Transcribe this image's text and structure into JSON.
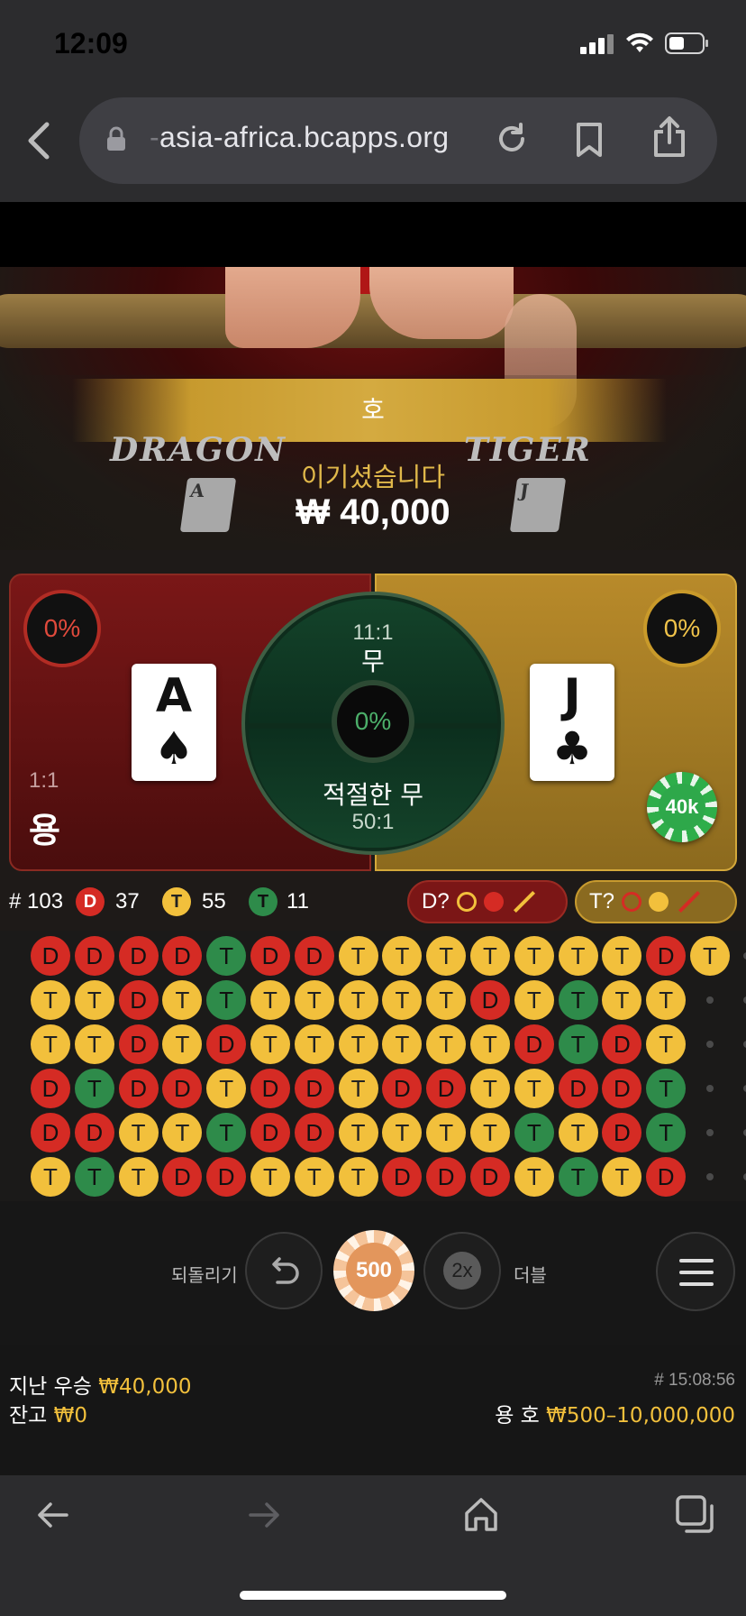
{
  "status_bar": {
    "time": "12:09"
  },
  "browser": {
    "url_prefix": "-",
    "url": "asia-africa.bcapps.org"
  },
  "video": {
    "banner_text": "호",
    "logo_dragon": "DRAGON",
    "logo_tiger": "TIGER",
    "small_card_dragon": "A",
    "small_card_tiger": "J",
    "win_label": "이기셨습니다",
    "win_amount": "₩ 40,000"
  },
  "bet": {
    "dragon": {
      "pct": "0%",
      "card_rank": "A",
      "card_suit": "♠",
      "odds": "1:1",
      "name": "용"
    },
    "tiger": {
      "pct": "0%",
      "card_rank": "J",
      "card_suit": "♣",
      "chip": "40k"
    },
    "tie": {
      "odds": "11:1",
      "label": "무",
      "pct": "0%"
    },
    "suited_tie": {
      "label": "적절한 무",
      "odds": "50:1"
    }
  },
  "stats": {
    "round": "# 103",
    "dragon_icon": "D",
    "dragon_count": "37",
    "tiger_icon": "T",
    "tiger_count": "55",
    "tie_icon": "T",
    "tie_count": "11",
    "pred_dragon": "D?",
    "pred_tiger": "T?"
  },
  "road": {
    "rows": [
      [
        "D",
        "D",
        "D",
        "D",
        "T",
        "D",
        "D",
        "T",
        "T",
        "T",
        "T",
        "T",
        "T",
        "T",
        "D",
        "T"
      ],
      [
        "T",
        "T",
        "D",
        "T",
        "T",
        "T",
        "T",
        "T",
        "T",
        "T",
        "D",
        "T",
        "T",
        "T",
        "T"
      ],
      [
        "T",
        "T",
        "D",
        "T",
        "D",
        "T",
        "T",
        "T",
        "T",
        "T",
        "T",
        "D",
        "T",
        "D",
        "T"
      ],
      [
        "D",
        "T",
        "D",
        "D",
        "T",
        "D",
        "D",
        "T",
        "D",
        "D",
        "T",
        "T",
        "D",
        "D",
        "T"
      ],
      [
        "D",
        "D",
        "T",
        "T",
        "T",
        "D",
        "D",
        "T",
        "T",
        "T",
        "T",
        "T",
        "T",
        "D",
        "T"
      ],
      [
        "T",
        "T",
        "T",
        "D",
        "D",
        "T",
        "T",
        "T",
        "D",
        "D",
        "D",
        "T",
        "T",
        "T",
        "D"
      ]
    ],
    "colors": [
      [
        "D",
        "D",
        "D",
        "D",
        "G",
        "D",
        "D",
        "T",
        "T",
        "T",
        "T",
        "T",
        "T",
        "T",
        "D",
        "T"
      ],
      [
        "T",
        "T",
        "D",
        "T",
        "G",
        "T",
        "T",
        "T",
        "T",
        "T",
        "D",
        "T",
        "G",
        "T",
        "T"
      ],
      [
        "T",
        "T",
        "D",
        "T",
        "D",
        "T",
        "T",
        "T",
        "T",
        "T",
        "T",
        "D",
        "G",
        "D",
        "T"
      ],
      [
        "D",
        "G",
        "D",
        "D",
        "T",
        "D",
        "D",
        "T",
        "D",
        "D",
        "T",
        "T",
        "D",
        "D",
        "G"
      ],
      [
        "D",
        "D",
        "T",
        "T",
        "G",
        "D",
        "D",
        "T",
        "T",
        "T",
        "T",
        "G",
        "T",
        "D",
        "G"
      ],
      [
        "T",
        "G",
        "T",
        "D",
        "D",
        "T",
        "T",
        "T",
        "D",
        "D",
        "D",
        "T",
        "G",
        "T",
        "D"
      ]
    ]
  },
  "controls": {
    "undo_label": "되돌리기",
    "chip_value": "500",
    "double_badge": "2x",
    "double_label": "더블"
  },
  "footer": {
    "last_win_label": "지난 우승",
    "last_win_amount": "₩40,000",
    "balance_label": "잔고",
    "balance_amount": "₩0",
    "game_id": "# 15:08:56",
    "limits_label": "용 호",
    "limits_amount": "₩500–10,000,000"
  }
}
